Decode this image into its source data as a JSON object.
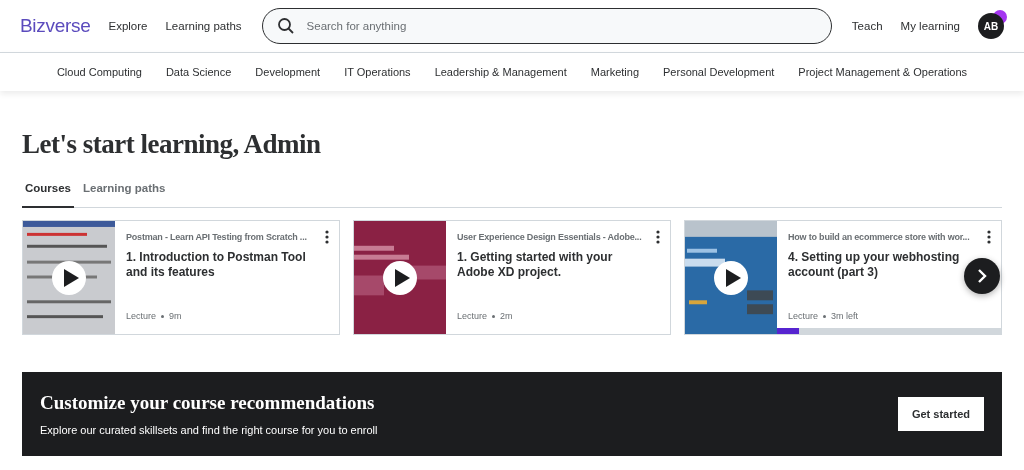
{
  "header": {
    "logo": "Bizverse",
    "nav": [
      "Explore",
      "Learning paths"
    ],
    "search": {
      "placeholder": "Search for anything"
    },
    "right_links": [
      "Teach",
      "My learning"
    ],
    "avatar": "AB"
  },
  "categories": [
    "Cloud Computing",
    "Data Science",
    "Development",
    "IT Operations",
    "Leadership & Management",
    "Marketing",
    "Personal Development",
    "Project Management & Operations"
  ],
  "greeting": "Let's start learning, Admin",
  "tabs": [
    {
      "label": "Courses",
      "selected": true
    },
    {
      "label": "Learning paths",
      "selected": false
    }
  ],
  "cards": [
    {
      "course": "Postman - Learn API Testing from Scratch ...",
      "lecture": "1. Introduction to Postman Tool and its features",
      "meta_type": "Lecture",
      "meta_time": "9m"
    },
    {
      "course": "User Experience Design Essentials - Adobe...",
      "lecture": "1. Getting started with your Adobe XD project.",
      "meta_type": "Lecture",
      "meta_time": "2m"
    },
    {
      "course": "How to build an ecommerce store with wor...",
      "lecture": "4. Setting up your webhosting account (part 3)",
      "meta_type": "Lecture",
      "meta_time": "3m left",
      "level": 0.1
    }
  ],
  "banner": {
    "title": "Customize your course recommendations",
    "text": "Explore our curated skillsets and find the right course for you to enroll",
    "button": "Get started"
  }
}
